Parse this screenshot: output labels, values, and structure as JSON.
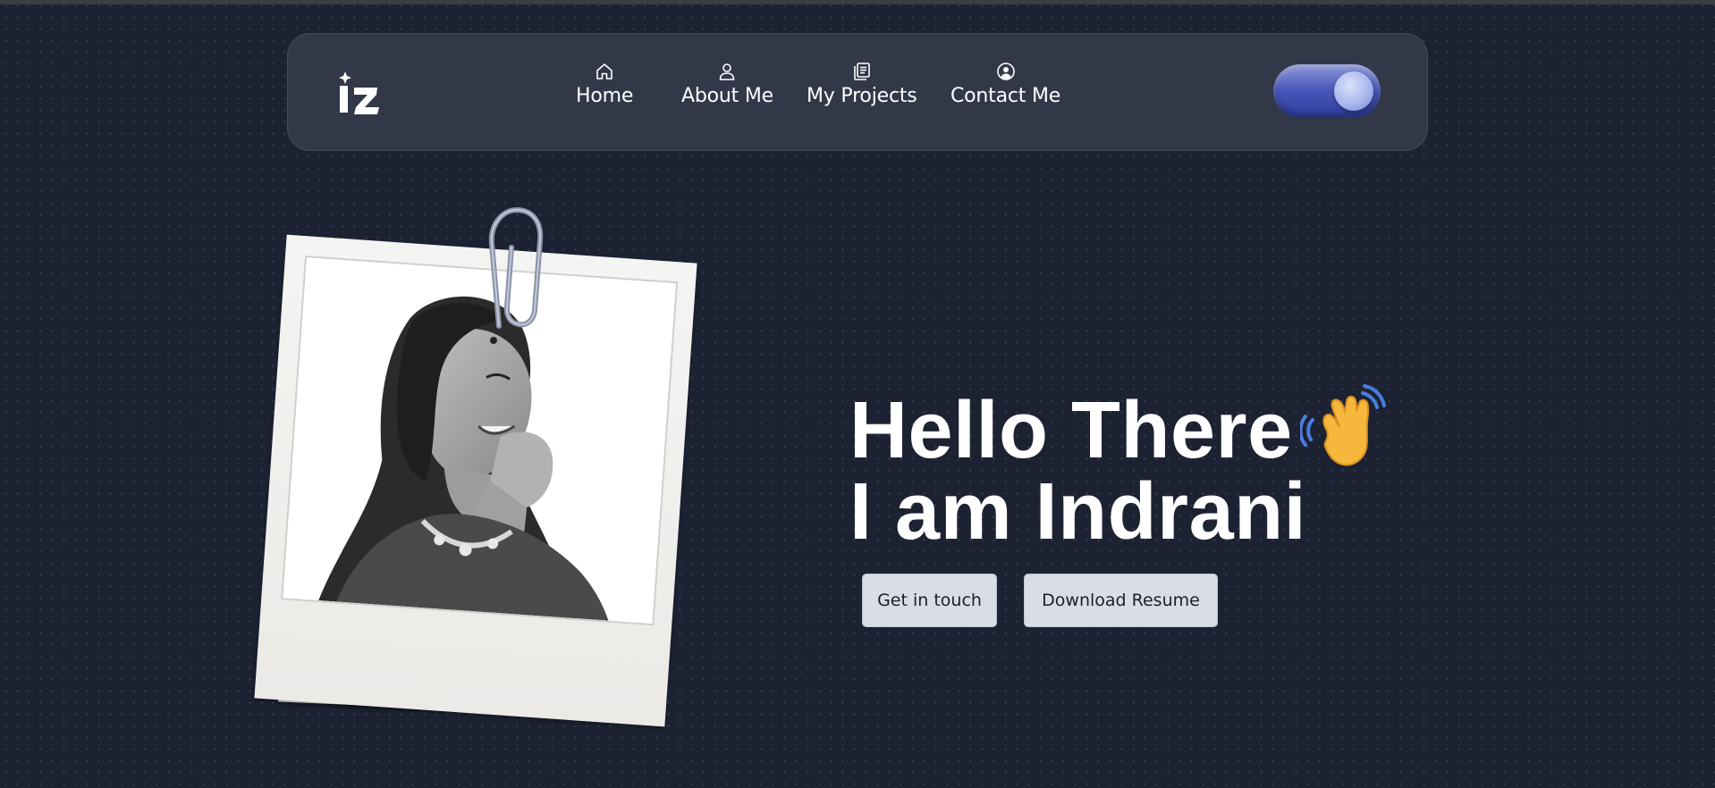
{
  "brand": {
    "logo_icon": "sparkle-monogram-logo"
  },
  "nav": {
    "items": [
      {
        "label": "Home",
        "icon": "home-icon"
      },
      {
        "label": "About Me",
        "icon": "user-icon"
      },
      {
        "label": "My Projects",
        "icon": "projects-icon"
      },
      {
        "label": "Contact Me",
        "icon": "contact-icon"
      }
    ]
  },
  "theme_toggle": {
    "state": "dark",
    "icon": "moon-icon"
  },
  "hero": {
    "line1": "Hello There",
    "line2": "I am Indrani",
    "wave_emoji": "waving-hand-icon",
    "buttons": {
      "get_in_touch": "Get in touch",
      "download_resume": "Download Resume"
    }
  },
  "colors": {
    "background": "#1c2232",
    "navbar": "#323848",
    "toggle_accent": "#4656b8",
    "button_bg": "#d8dde6",
    "text": "#ffffff"
  }
}
